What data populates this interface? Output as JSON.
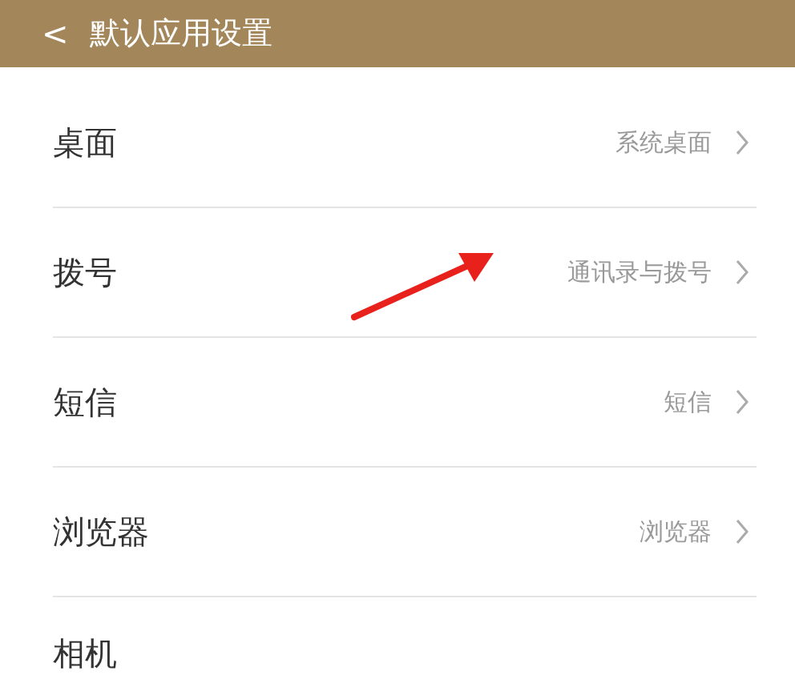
{
  "header": {
    "back": "<",
    "title": "默认应用设置"
  },
  "rows": [
    {
      "label": "桌面",
      "value": "系统桌面",
      "chevron": true
    },
    {
      "label": "拨号",
      "value": "通讯录与拨号",
      "chevron": true
    },
    {
      "label": "短信",
      "value": "短信",
      "chevron": true
    },
    {
      "label": "浏览器",
      "value": "浏览器",
      "chevron": true
    },
    {
      "label": "相机",
      "chevron": false
    }
  ]
}
